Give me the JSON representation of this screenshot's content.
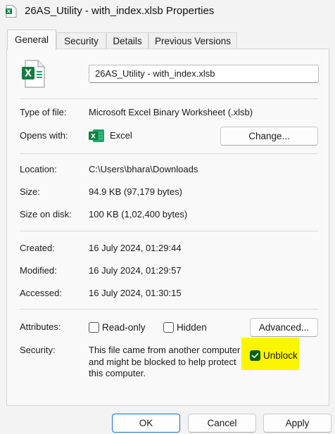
{
  "window": {
    "title": "26AS_Utility - with_index.xlsb Properties"
  },
  "tabs": [
    {
      "label": "General",
      "active": true
    },
    {
      "label": "Security",
      "active": false
    },
    {
      "label": "Details",
      "active": false
    },
    {
      "label": "Previous Versions",
      "active": false
    }
  ],
  "file": {
    "name": "26AS_Utility - with_index.xlsb",
    "type_label": "Type of file:",
    "type_value": "Microsoft Excel Binary Worksheet (.xlsb)",
    "opens_label": "Opens with:",
    "opens_value": "Excel",
    "change_button": "Change..."
  },
  "location": {
    "location_label": "Location:",
    "location_value": "C:\\Users\\bhara\\Downloads",
    "size_label": "Size:",
    "size_value": "94.9 KB (97,179 bytes)",
    "size_on_disk_label": "Size on disk:",
    "size_on_disk_value": "100 KB (1,02,400 bytes)"
  },
  "dates": {
    "created_label": "Created:",
    "created_value": "16 July 2024, 01:29:44",
    "modified_label": "Modified:",
    "modified_value": "16 July 2024, 01:29:57",
    "accessed_label": "Accessed:",
    "accessed_value": "16 July 2024, 01:30:15"
  },
  "attributes": {
    "label": "Attributes:",
    "read_only": {
      "label": "Read-only",
      "checked": false
    },
    "hidden": {
      "label": "Hidden",
      "checked": false
    },
    "advanced_button": "Advanced..."
  },
  "security": {
    "label": "Security:",
    "message_lines": [
      "This file came from another computer",
      "and might be blocked to help protect",
      "this computer."
    ],
    "unblock": {
      "label": "Unblock",
      "checked": true
    }
  },
  "footer": {
    "ok": "OK",
    "cancel": "Cancel",
    "apply": "Apply"
  },
  "colors": {
    "excel_green": "#107c41",
    "highlight": "#fbf600",
    "checkbox_checked": "#0a5e1a",
    "default_button_border": "#1a6fc4"
  }
}
